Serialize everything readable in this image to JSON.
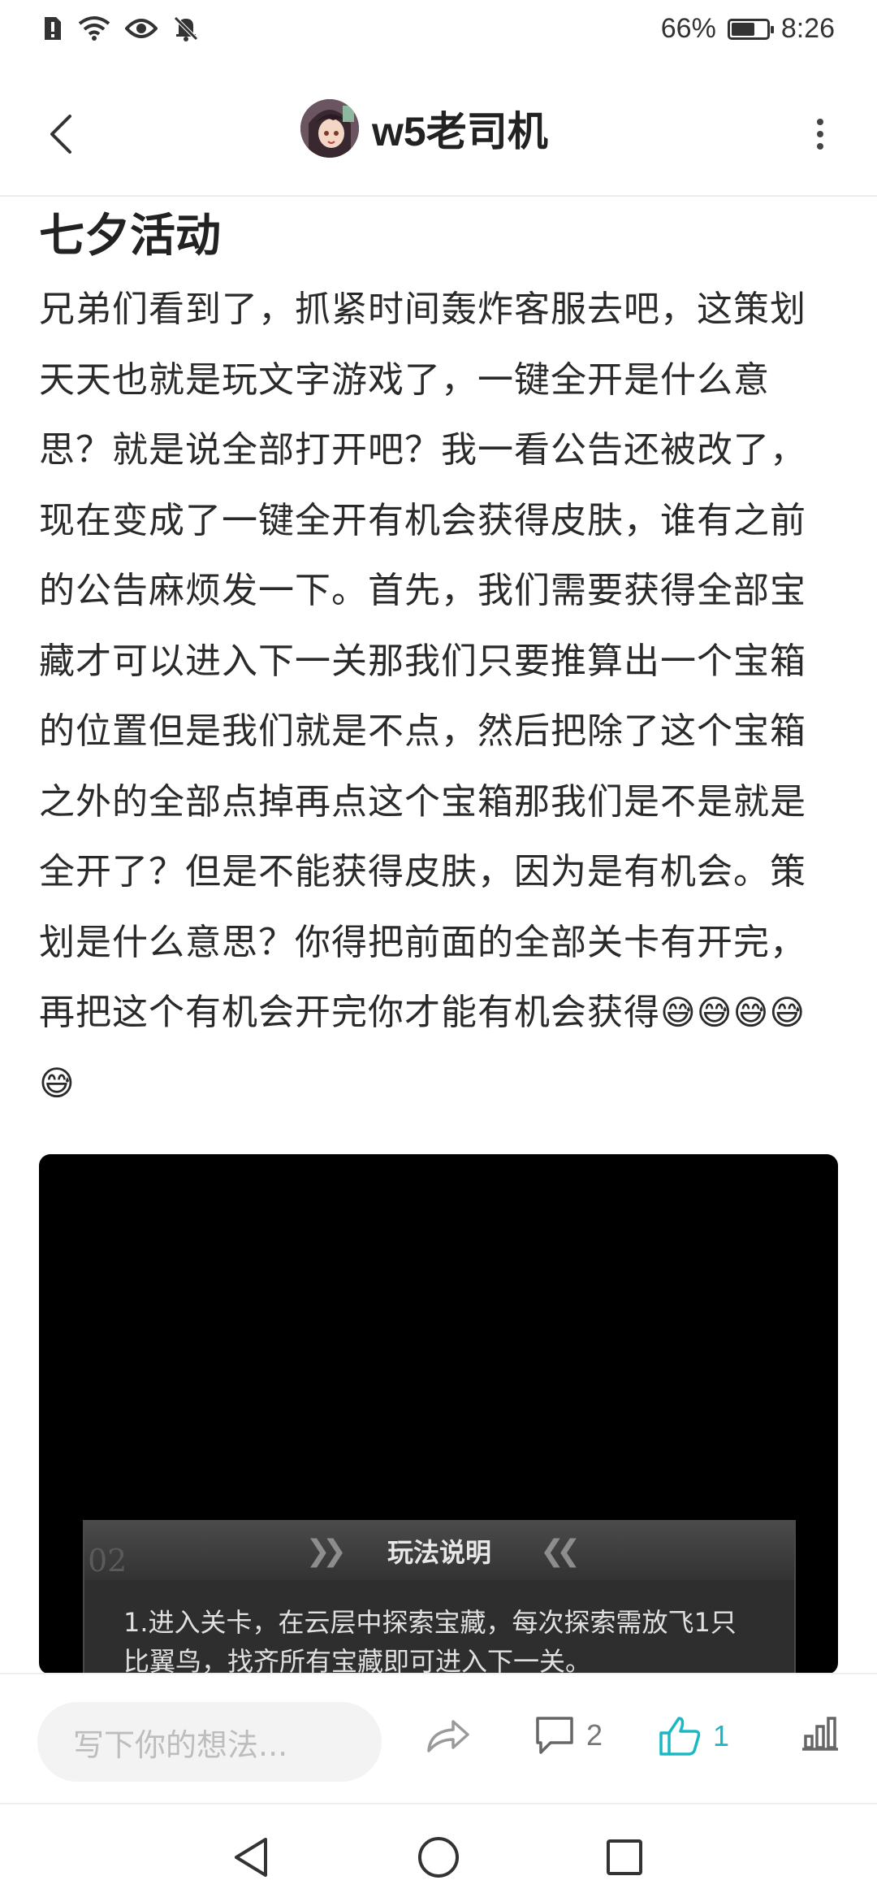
{
  "status_bar": {
    "battery_percent": "66%",
    "battery_level": 0.66,
    "time": "8:26",
    "icons": [
      "alert-sim-icon",
      "wifi-icon",
      "eye-comfort-icon",
      "mute-bell-icon"
    ]
  },
  "header": {
    "title": "w5老司机",
    "back_icon": "chevron-left-icon",
    "more_icon": "more-vertical-icon"
  },
  "post": {
    "title": "七夕活动",
    "body": "兄弟们看到了，抓紧时间轰炸客服去吧，这策划天天也就是玩文字游戏了，一键全开是什么意思？就是说全部打开吧？我一看公告还被改了，现在变成了一键全开有机会获得皮肤，谁有之前的公告麻烦发一下。首先，我们需要获得全部宝藏才可以进入下一关那我们只要推算出一个宝箱的位置但是我们就是不点，然后把除了这个宝箱之外的全部点掉再点这个宝箱那我们是不是就是全开了？但是不能获得皮肤，因为是有机会。策划是什么意思？你得把前面的全部关卡有开完，再把这个有机会开完你才能有机会获得",
    "emojis": "😅😅😅😅😅"
  },
  "image": {
    "dialog_number": "02",
    "dialog_title": "玩法说明",
    "dialog_line1": "1.进入关卡，在云层中探索宝藏，每次探索需放飞1只",
    "dialog_line2": "比翼鸟，找齐所有宝藏即可进入下一关。"
  },
  "actions": {
    "comment_placeholder": "写下你的想法...",
    "comment_count": "2",
    "like_count": "1",
    "accent_color": "#1bb8c4"
  }
}
